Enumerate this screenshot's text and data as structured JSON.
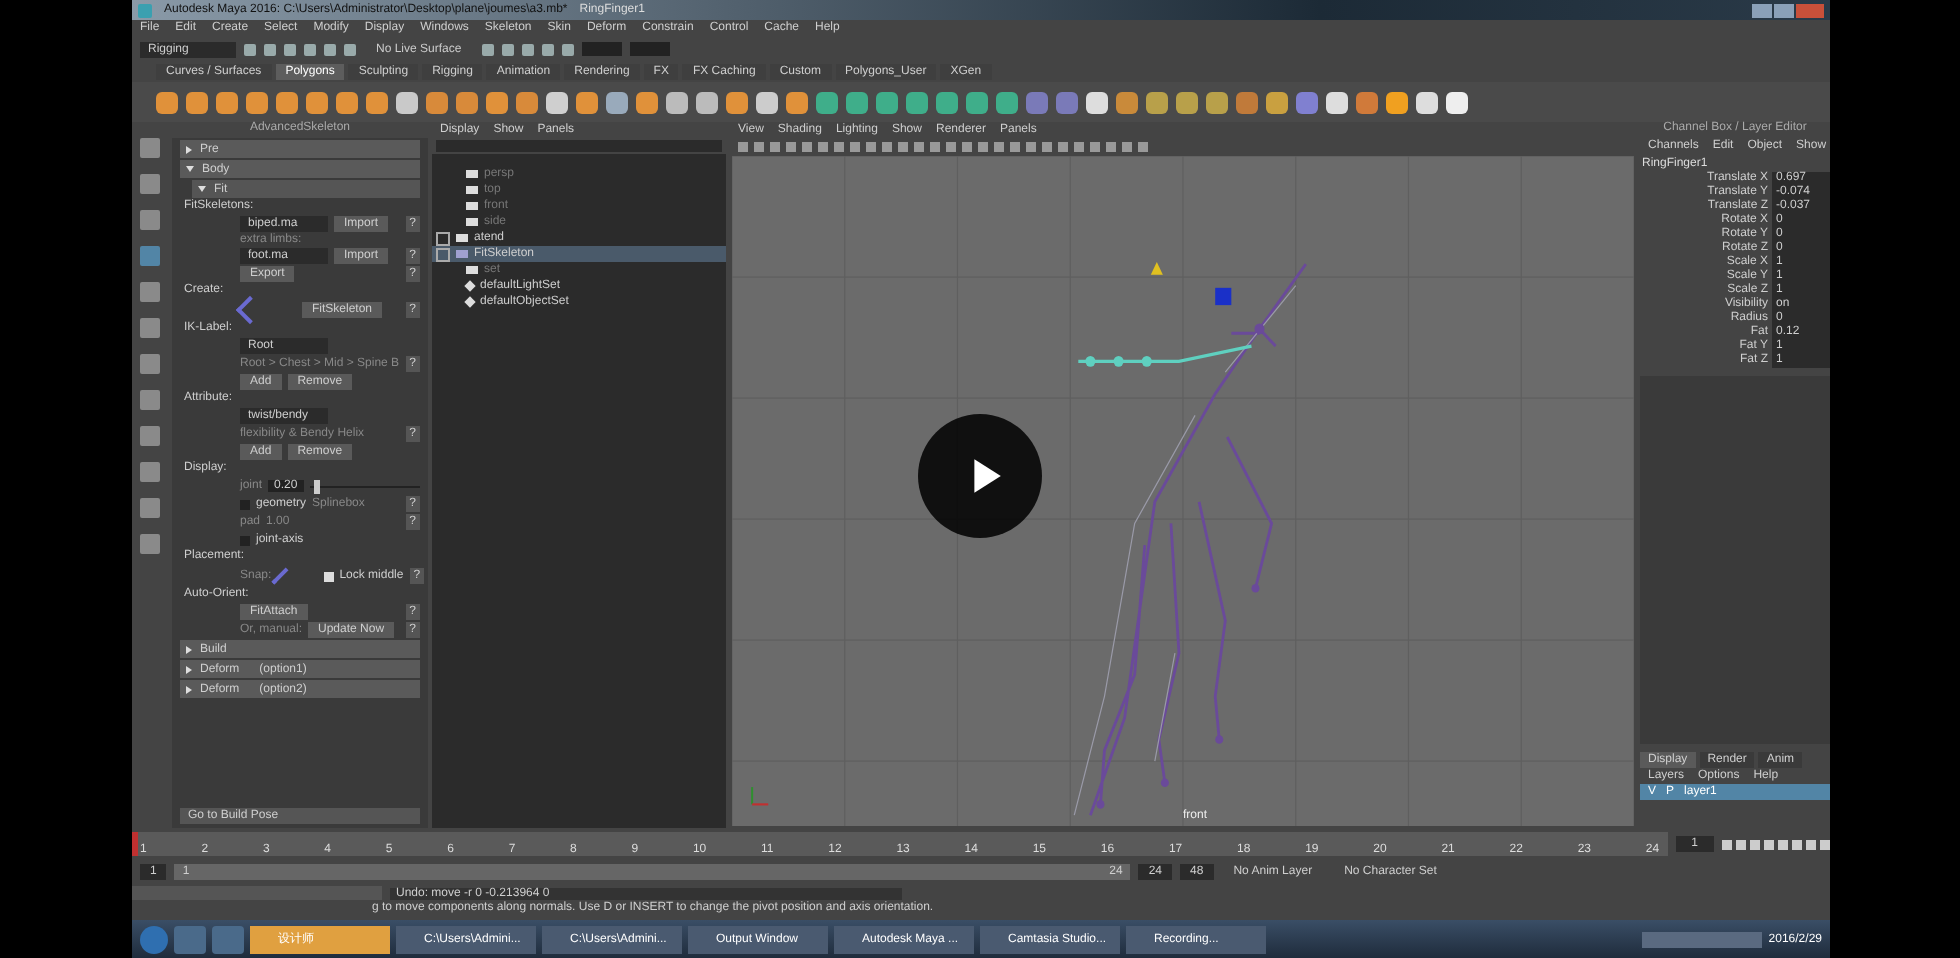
{
  "window": {
    "title": "Autodesk Maya 2016: C:\\Users\\Administrator\\Desktop\\plane\\joumes\\a3.mb*",
    "subtitle": "RingFinger1"
  },
  "menu": [
    "File",
    "Edit",
    "Create",
    "Select",
    "Modify",
    "Display",
    "Windows",
    "Skeleton",
    "Skin",
    "Deform",
    "Constrain",
    "Control",
    "Cache",
    "Help"
  ],
  "status_line": {
    "mode": "Rigging",
    "live_surface": "No Live Surface"
  },
  "shelf_tabs": [
    {
      "label": "Curves / Surfaces",
      "selected": false
    },
    {
      "label": "Polygons",
      "selected": true
    },
    {
      "label": "Sculpting",
      "selected": false
    },
    {
      "label": "Rigging",
      "selected": false
    },
    {
      "label": "Animation",
      "selected": false
    },
    {
      "label": "Rendering",
      "selected": false
    },
    {
      "label": "FX",
      "selected": false
    },
    {
      "label": "FX Caching",
      "selected": false
    },
    {
      "label": "Custom",
      "selected": false
    },
    {
      "label": "Polygons_User",
      "selected": false
    },
    {
      "label": "XGen",
      "selected": false
    }
  ],
  "advanced_skeleton": {
    "title": "AdvancedSkeleton",
    "rows": [
      {
        "kind": "section",
        "label": "Pre",
        "expanded": false
      },
      {
        "kind": "section",
        "label": "Body",
        "expanded": true
      },
      {
        "kind": "subsection",
        "label": "Fit",
        "expanded": true
      },
      {
        "kind": "heading",
        "text": "FitSkeletons:"
      },
      {
        "kind": "row",
        "parts": [
          {
            "kind": "dropdown",
            "text": "biped.ma"
          },
          {
            "kind": "button",
            "text": "Import"
          },
          {
            "kind": "help",
            "text": "?"
          }
        ]
      },
      {
        "kind": "hint",
        "text": "extra limbs:"
      },
      {
        "kind": "row",
        "parts": [
          {
            "kind": "dropdown",
            "text": "foot.ma"
          },
          {
            "kind": "button",
            "text": "Import"
          },
          {
            "kind": "help",
            "text": "?"
          }
        ]
      },
      {
        "kind": "row",
        "parts": [
          {
            "kind": "button",
            "text": "Export"
          },
          {
            "kind": "help",
            "text": "?"
          }
        ]
      },
      {
        "kind": "heading",
        "text": "Create:"
      },
      {
        "kind": "row",
        "parts": [
          {
            "kind": "icon"
          },
          {
            "kind": "button",
            "text": "FitSkeleton"
          },
          {
            "kind": "help",
            "text": "?"
          }
        ]
      },
      {
        "kind": "heading",
        "text": "IK-Label:"
      },
      {
        "kind": "row",
        "parts": [
          {
            "kind": "dropdown",
            "text": "Root"
          }
        ]
      },
      {
        "kind": "row",
        "parts": [
          {
            "kind": "hint",
            "text": "Root > Chest > Mid > Spine B"
          },
          {
            "kind": "help",
            "text": "?"
          }
        ]
      },
      {
        "kind": "row",
        "parts": [
          {
            "kind": "button",
            "text": "Add"
          },
          {
            "kind": "button",
            "text": "Remove"
          }
        ]
      },
      {
        "kind": "heading",
        "text": "Attribute:"
      },
      {
        "kind": "row",
        "parts": [
          {
            "kind": "dropdown",
            "text": "twist/bendy"
          }
        ]
      },
      {
        "kind": "row",
        "parts": [
          {
            "kind": "hint",
            "text": "flexibility & Bendy Helix"
          },
          {
            "kind": "help",
            "text": "?"
          }
        ]
      },
      {
        "kind": "row",
        "parts": [
          {
            "kind": "button",
            "text": "Add"
          },
          {
            "kind": "button",
            "text": "Remove"
          }
        ]
      },
      {
        "kind": "heading",
        "text": "Display:"
      },
      {
        "kind": "row",
        "parts": [
          {
            "kind": "slider",
            "label": "joint",
            "value": "0.20",
            "level": 0.05
          }
        ]
      },
      {
        "kind": "row",
        "parts": [
          {
            "kind": "checkbox",
            "label": "geometry",
            "checked": false
          },
          {
            "kind": "hint",
            "text": "Splinebox"
          },
          {
            "kind": "help",
            "text": "?"
          }
        ]
      },
      {
        "kind": "row",
        "parts": [
          {
            "kind": "hint",
            "text": "pad"
          },
          {
            "kind": "hint",
            "text": "1.00"
          },
          {
            "kind": "help",
            "text": "?"
          }
        ]
      },
      {
        "kind": "row",
        "parts": [
          {
            "kind": "checkbox",
            "label": "joint-axis",
            "checked": false
          }
        ]
      },
      {
        "kind": "heading",
        "text": "Placement:"
      },
      {
        "kind": "row",
        "parts": [
          {
            "kind": "hint",
            "text": "Snap:"
          },
          {
            "kind": "icon"
          },
          {
            "kind": "checkbox",
            "label": "Lock middle",
            "checked": true
          },
          {
            "kind": "help",
            "text": "?"
          }
        ]
      },
      {
        "kind": "heading",
        "text": "Auto-Orient:"
      },
      {
        "kind": "row",
        "parts": [
          {
            "kind": "button",
            "text": "FitAttach"
          },
          {
            "kind": "help",
            "text": "?"
          }
        ]
      },
      {
        "kind": "row",
        "parts": [
          {
            "kind": "hint",
            "text": "Or, manual:"
          },
          {
            "kind": "button",
            "text": "Update Now"
          },
          {
            "kind": "help",
            "text": "?"
          }
        ]
      },
      {
        "kind": "section",
        "label": "Build",
        "expanded": false
      },
      {
        "kind": "section",
        "label": "Deform      (option1)",
        "expanded": false
      },
      {
        "kind": "section",
        "label": "Deform      (option2)",
        "expanded": false
      }
    ],
    "footer_button": "Go to Build Pose"
  },
  "outliner": {
    "menu": [
      "Display",
      "Show",
      "Panels"
    ],
    "items": [
      {
        "kind": "camera",
        "label": "persp",
        "selected": false
      },
      {
        "kind": "camera",
        "label": "top",
        "selected": false
      },
      {
        "kind": "camera",
        "label": "front",
        "selected": false
      },
      {
        "kind": "camera",
        "label": "side",
        "selected": false
      },
      {
        "kind": "group",
        "label": "atend",
        "selected": false
      },
      {
        "kind": "joint",
        "label": "FitSkeleton",
        "selected": true
      },
      {
        "kind": "camera",
        "label": "set",
        "selected": false
      },
      {
        "kind": "set",
        "label": "defaultLightSet",
        "selected": false
      },
      {
        "kind": "set",
        "label": "defaultObjectSet",
        "selected": false
      }
    ]
  },
  "viewport": {
    "menu": [
      "View",
      "Shading",
      "Lighting",
      "Show",
      "Renderer",
      "Panels"
    ],
    "camera_label": "front"
  },
  "channel_box": {
    "title": "Channel Box / Layer Editor",
    "menu": [
      "Channels",
      "Edit",
      "Object",
      "Show"
    ],
    "object": "RingFinger1",
    "channels": [
      {
        "name": "Translate X",
        "value": "0.697"
      },
      {
        "name": "Translate Y",
        "value": "-0.074"
      },
      {
        "name": "Translate Z",
        "value": "-0.037"
      },
      {
        "name": "Rotate X",
        "value": "0"
      },
      {
        "name": "Rotate Y",
        "value": "0"
      },
      {
        "name": "Rotate Z",
        "value": "0"
      },
      {
        "name": "Scale X",
        "value": "1"
      },
      {
        "name": "Scale Y",
        "value": "1"
      },
      {
        "name": "Scale Z",
        "value": "1"
      },
      {
        "name": "Visibility",
        "value": "on"
      },
      {
        "name": "Radius",
        "value": "0"
      },
      {
        "name": "Fat",
        "value": "0.12"
      },
      {
        "name": "Fat Y",
        "value": "1"
      },
      {
        "name": "Fat Z",
        "value": "1"
      }
    ],
    "layer_tabs": [
      {
        "label": "Display",
        "selected": true
      },
      {
        "label": "Render",
        "selected": false
      },
      {
        "label": "Anim",
        "selected": false
      }
    ],
    "layer_menu": [
      "Layers",
      "Options",
      "Help"
    ],
    "layers": [
      {
        "visible": "V",
        "playback": "P",
        "name": "layer1",
        "selected": true
      }
    ]
  },
  "timeline": {
    "frames": [
      "1",
      "2",
      "3",
      "4",
      "5",
      "6",
      "7",
      "8",
      "9",
      "10",
      "11",
      "12",
      "13",
      "14",
      "15",
      "16",
      "17",
      "18",
      "19",
      "20",
      "21",
      "22",
      "23",
      "24"
    ],
    "current_frame": "1",
    "level": 0
  },
  "range_slider": {
    "start": "1",
    "inner_start": "1",
    "inner_end": "24",
    "end": "24",
    "max": "48",
    "level": 1,
    "anim_layer": "No Anim Layer",
    "character_set": "No Character Set"
  },
  "command_line": {
    "result": "Undo: move -r 0 -0.213964 0"
  },
  "help_line": "g to move components along normals. Use D or INSERT to change the pivot position and axis orientation.",
  "taskbar": {
    "tasks": [
      {
        "label": "设计师",
        "selected": true
      },
      {
        "label": "C:\\Users\\Admini...",
        "selected": false
      },
      {
        "label": "C:\\Users\\Admini...",
        "selected": false
      },
      {
        "label": "Output Window",
        "selected": false
      },
      {
        "label": "Autodesk Maya ...",
        "selected": false
      },
      {
        "label": "Camtasia Studio...",
        "selected": false
      },
      {
        "label": "Recording...",
        "selected": false
      }
    ],
    "date": "2016/2/29"
  }
}
